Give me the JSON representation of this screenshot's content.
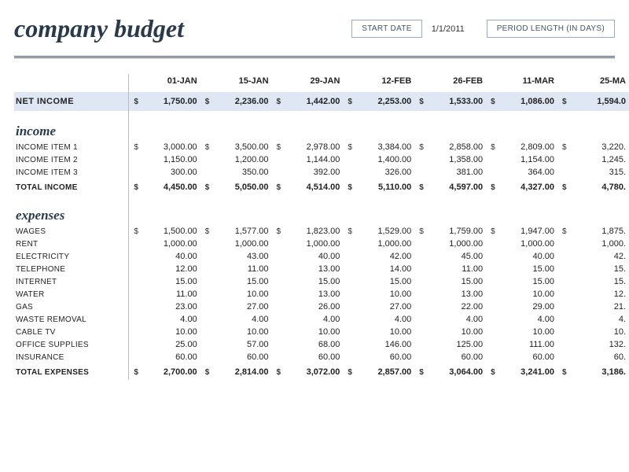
{
  "header": {
    "title": "company budget",
    "start_date_label": "START DATE",
    "start_date_value": "1/1/2011",
    "period_length_label": "PERIOD LENGTH (IN DAYS)"
  },
  "columns": [
    "01-JAN",
    "15-JAN",
    "29-JAN",
    "12-FEB",
    "26-FEB",
    "11-MAR",
    "25-MA"
  ],
  "net_income": {
    "label": "NET INCOME",
    "values": [
      "1,750.00",
      "2,236.00",
      "1,442.00",
      "2,253.00",
      "1,533.00",
      "1,086.00",
      "1,594.0"
    ]
  },
  "income": {
    "heading": "income",
    "rows": [
      {
        "label": "INCOME ITEM 1",
        "values": [
          "3,000.00",
          "3,500.00",
          "2,978.00",
          "3,384.00",
          "2,858.00",
          "2,809.00",
          "3,220."
        ],
        "dollar": true
      },
      {
        "label": "INCOME ITEM 2",
        "values": [
          "1,150.00",
          "1,200.00",
          "1,144.00",
          "1,400.00",
          "1,358.00",
          "1,154.00",
          "1,245."
        ],
        "dollar": false
      },
      {
        "label": "INCOME ITEM 3",
        "values": [
          "300.00",
          "350.00",
          "392.00",
          "326.00",
          "381.00",
          "364.00",
          "315."
        ],
        "dollar": false
      }
    ],
    "total": {
      "label": "TOTAL INCOME",
      "values": [
        "4,450.00",
        "5,050.00",
        "4,514.00",
        "5,110.00",
        "4,597.00",
        "4,327.00",
        "4,780."
      ]
    }
  },
  "expenses": {
    "heading": "expenses",
    "rows": [
      {
        "label": "WAGES",
        "values": [
          "1,500.00",
          "1,577.00",
          "1,823.00",
          "1,529.00",
          "1,759.00",
          "1,947.00",
          "1,875."
        ],
        "dollar": true
      },
      {
        "label": "RENT",
        "values": [
          "1,000.00",
          "1,000.00",
          "1,000.00",
          "1,000.00",
          "1,000.00",
          "1,000.00",
          "1,000."
        ],
        "dollar": false
      },
      {
        "label": "ELECTRICITY",
        "values": [
          "40.00",
          "43.00",
          "40.00",
          "42.00",
          "45.00",
          "40.00",
          "42."
        ],
        "dollar": false
      },
      {
        "label": "TELEPHONE",
        "values": [
          "12.00",
          "11.00",
          "13.00",
          "14.00",
          "11.00",
          "15.00",
          "15."
        ],
        "dollar": false
      },
      {
        "label": "INTERNET",
        "values": [
          "15.00",
          "15.00",
          "15.00",
          "15.00",
          "15.00",
          "15.00",
          "15."
        ],
        "dollar": false
      },
      {
        "label": "WATER",
        "values": [
          "11.00",
          "10.00",
          "13.00",
          "10.00",
          "13.00",
          "10.00",
          "12."
        ],
        "dollar": false
      },
      {
        "label": "GAS",
        "values": [
          "23.00",
          "27.00",
          "26.00",
          "27.00",
          "22.00",
          "29.00",
          "21."
        ],
        "dollar": false
      },
      {
        "label": "WASTE REMOVAL",
        "values": [
          "4.00",
          "4.00",
          "4.00",
          "4.00",
          "4.00",
          "4.00",
          "4."
        ],
        "dollar": false
      },
      {
        "label": "CABLE TV",
        "values": [
          "10.00",
          "10.00",
          "10.00",
          "10.00",
          "10.00",
          "10.00",
          "10."
        ],
        "dollar": false
      },
      {
        "label": "OFFICE SUPPLIES",
        "values": [
          "25.00",
          "57.00",
          "68.00",
          "146.00",
          "125.00",
          "111.00",
          "132."
        ],
        "dollar": false
      },
      {
        "label": "INSURANCE",
        "values": [
          "60.00",
          "60.00",
          "60.00",
          "60.00",
          "60.00",
          "60.00",
          "60."
        ],
        "dollar": false
      }
    ],
    "total": {
      "label": "TOTAL EXPENSES",
      "values": [
        "2,700.00",
        "2,814.00",
        "3,072.00",
        "2,857.00",
        "3,064.00",
        "3,241.00",
        "3,186."
      ]
    }
  }
}
